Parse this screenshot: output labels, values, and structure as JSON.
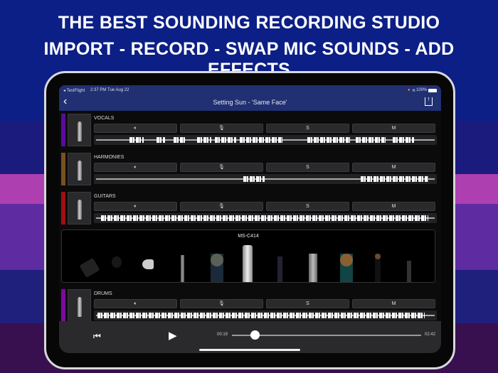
{
  "headline": {
    "line1": "THE BEST SOUNDING RECORDING STUDIO",
    "line2": "IMPORT - RECORD - SWAP MIC SOUNDS - ADD EFFECTS"
  },
  "status_bar": {
    "back_app": "◂ TestFlight",
    "time": "2:37 PM",
    "date": "Tue Aug 22",
    "battery": "100%"
  },
  "nav": {
    "title": "Setting Sun - 'Same Face'"
  },
  "buttons": {
    "solo": "S",
    "mute": "M"
  },
  "tracks": [
    {
      "name": "VOCALS",
      "color": "#5a0aa0"
    },
    {
      "name": "HARMONIES",
      "color": "#7a5020"
    },
    {
      "name": "GUITARS",
      "color": "#a01010"
    },
    {
      "name": "DRUMS",
      "color": "#7a0aa0"
    }
  ],
  "mic_picker": {
    "selected": "MS-C414"
  },
  "player": {
    "current_time": "00:19",
    "total_time": "02:42",
    "progress": 0.12
  }
}
